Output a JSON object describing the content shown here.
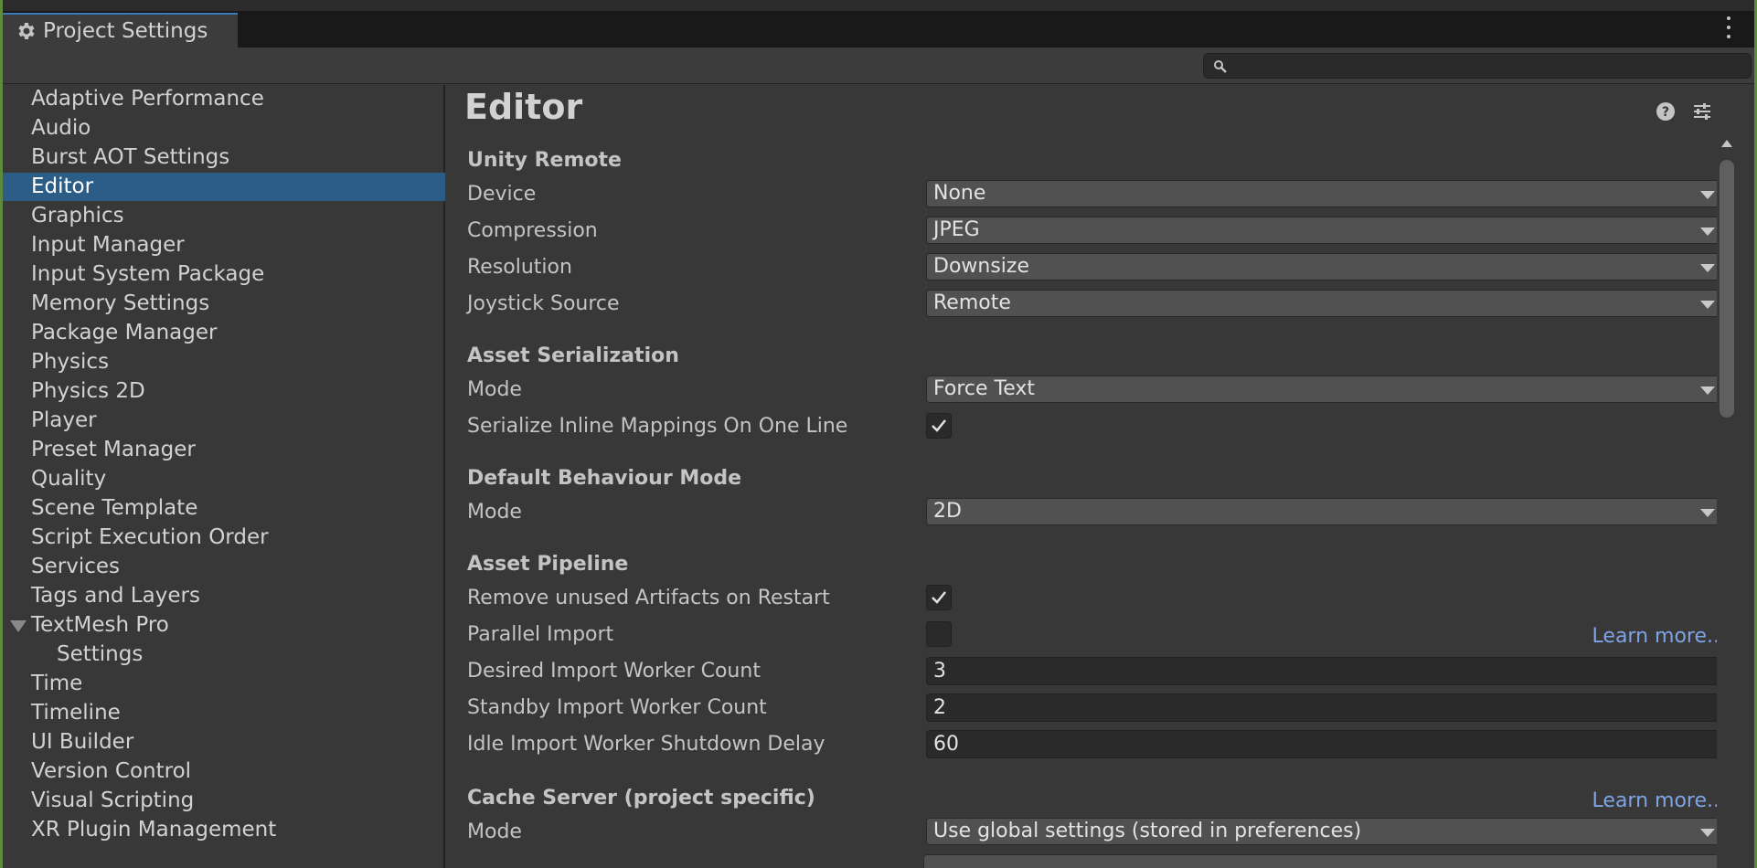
{
  "window": {
    "tab_title": "Project Settings",
    "tab_icon": "gear-icon"
  },
  "search": {
    "value": "",
    "placeholder": ""
  },
  "sidebar": {
    "items": [
      {
        "label": "Adaptive Performance"
      },
      {
        "label": "Audio"
      },
      {
        "label": "Burst AOT Settings"
      },
      {
        "label": "Editor",
        "selected": true
      },
      {
        "label": "Graphics"
      },
      {
        "label": "Input Manager"
      },
      {
        "label": "Input System Package"
      },
      {
        "label": "Memory Settings"
      },
      {
        "label": "Package Manager"
      },
      {
        "label": "Physics"
      },
      {
        "label": "Physics 2D"
      },
      {
        "label": "Player"
      },
      {
        "label": "Preset Manager"
      },
      {
        "label": "Quality"
      },
      {
        "label": "Scene Template"
      },
      {
        "label": "Script Execution Order"
      },
      {
        "label": "Services"
      },
      {
        "label": "Tags and Layers"
      },
      {
        "label": "TextMesh Pro",
        "expanded": true
      },
      {
        "label": "Settings",
        "child": true
      },
      {
        "label": "Time"
      },
      {
        "label": "Timeline"
      },
      {
        "label": "UI Builder"
      },
      {
        "label": "Version Control"
      },
      {
        "label": "Visual Scripting"
      },
      {
        "label": "XR Plugin Management"
      }
    ]
  },
  "page": {
    "title": "Editor",
    "unity_remote": {
      "header": "Unity Remote",
      "device_label": "Device",
      "device_value": "None",
      "compression_label": "Compression",
      "compression_value": "JPEG",
      "resolution_label": "Resolution",
      "resolution_value": "Downsize",
      "joystick_label": "Joystick Source",
      "joystick_value": "Remote"
    },
    "asset_serialization": {
      "header": "Asset Serialization",
      "mode_label": "Mode",
      "mode_value": "Force Text",
      "inline_label": "Serialize Inline Mappings On One Line",
      "inline_checked": true
    },
    "default_behaviour": {
      "header": "Default Behaviour Mode",
      "mode_label": "Mode",
      "mode_value": "2D"
    },
    "asset_pipeline": {
      "header": "Asset Pipeline",
      "remove_label": "Remove unused Artifacts on Restart",
      "remove_checked": true,
      "parallel_label": "Parallel Import",
      "parallel_checked": false,
      "learn_more": "Learn more...",
      "desired_label": "Desired Import Worker Count",
      "desired_value": "3",
      "standby_label": "Standby Import Worker Count",
      "standby_value": "2",
      "idle_label": "Idle Import Worker Shutdown Delay",
      "idle_value": "60"
    },
    "cache_server": {
      "header": "Cache Server (project specific)",
      "learn_more": "Learn more...",
      "mode_label": "Mode",
      "mode_value": "Use global settings (stored in preferences)"
    }
  },
  "colors": {
    "selection": "#2c5d87",
    "link": "#7ea4e6",
    "tab_accent": "#3a79bb",
    "window_border": "#5d8a3c"
  }
}
